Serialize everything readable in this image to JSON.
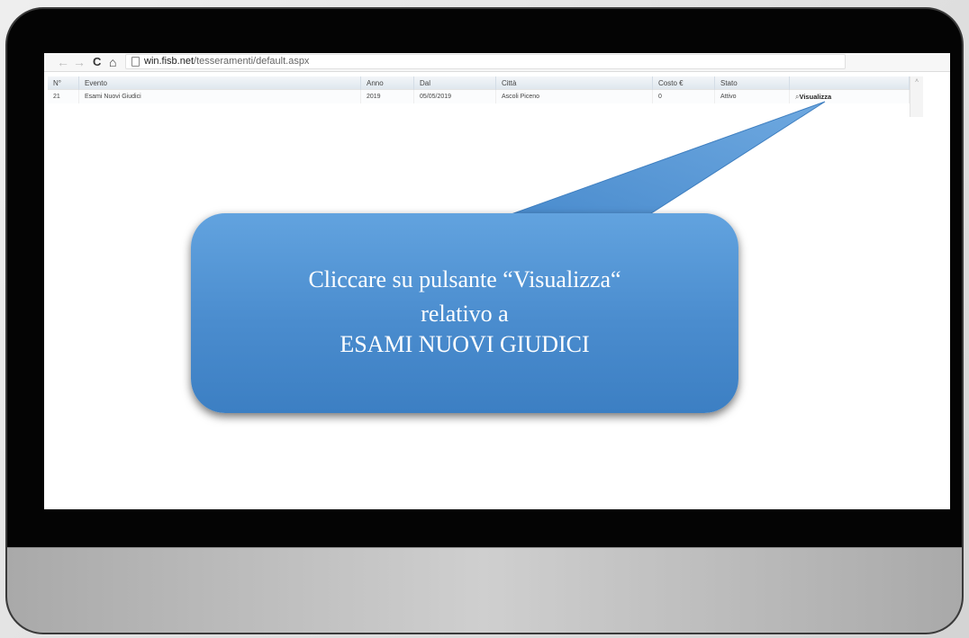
{
  "browser": {
    "back": "←",
    "forward": "→",
    "reload": "C",
    "home": "⌂",
    "url_domain": "win.fisb.net",
    "url_path": "/tesseramenti/default.aspx"
  },
  "table": {
    "headers": [
      "N°",
      "Evento",
      "Anno",
      "Dal",
      "Città",
      "Costo €",
      "Stato",
      ""
    ],
    "rows": [
      {
        "num": "21",
        "evento": "Esami Nuovi Giudici",
        "anno": "2019",
        "dal": "05/05/2019",
        "citta": "Ascoli Piceno",
        "costo": "0",
        "stato": "Attivo",
        "action": "Visualizza"
      }
    ]
  },
  "callout": {
    "line1": "Cliccare su pulsante “Visualizza“",
    "line2": "relativo a",
    "line3": "ESAMI NUOVI GIUDICI"
  },
  "colors": {
    "callout": "#4a8cce",
    "bezel": "#040404"
  }
}
